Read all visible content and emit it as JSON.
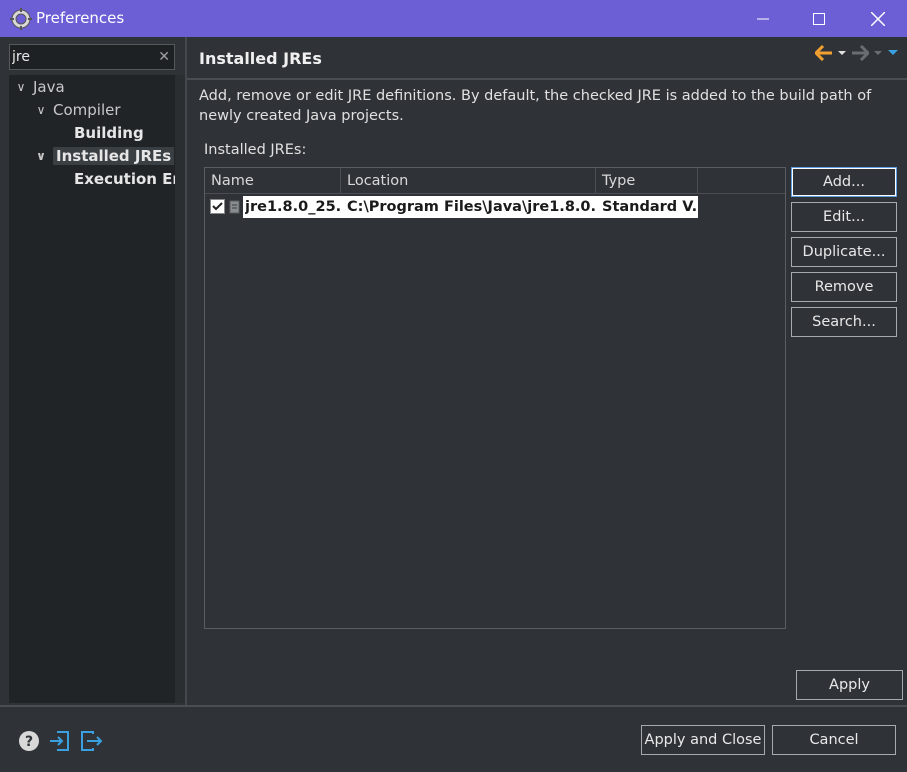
{
  "window": {
    "title": "Preferences",
    "minimize_icon": "minimize-icon",
    "maximize_icon": "maximize-icon",
    "close_icon": "close-icon"
  },
  "sidebar": {
    "filter_value": "jre",
    "tree": [
      {
        "label": "Java",
        "expanded": true,
        "bold": false
      },
      {
        "label": "Compiler",
        "expanded": true,
        "bold": false
      },
      {
        "label": "Building",
        "expanded": false,
        "bold": true
      },
      {
        "label": "Installed JREs",
        "expanded": true,
        "bold": true,
        "selected": true
      },
      {
        "label": "Execution Envi",
        "expanded": false,
        "bold": true
      }
    ]
  },
  "page": {
    "title": "Installed JREs",
    "description": "Add, remove or edit JRE definitions. By default, the checked JRE is added to the build path of newly created Java projects.",
    "list_label": "Installed JREs:",
    "table": {
      "columns": [
        "Name",
        "Location",
        "Type"
      ],
      "rows": [
        {
          "checked": true,
          "name": "jre1.8.0_25...",
          "location": "C:\\Program Files\\Java\\jre1.8.0...",
          "type": "Standard V..."
        }
      ]
    },
    "buttons": {
      "add": "Add...",
      "edit": "Edit...",
      "duplicate": "Duplicate...",
      "remove": "Remove",
      "search": "Search..."
    },
    "apply": "Apply"
  },
  "footer": {
    "apply_close": "Apply and Close",
    "cancel": "Cancel"
  },
  "colors": {
    "titlebar": "#6c5fd6",
    "background": "#2f3337",
    "accent_arrow": "#f0a030",
    "accent_blue": "#3aa0e0"
  }
}
